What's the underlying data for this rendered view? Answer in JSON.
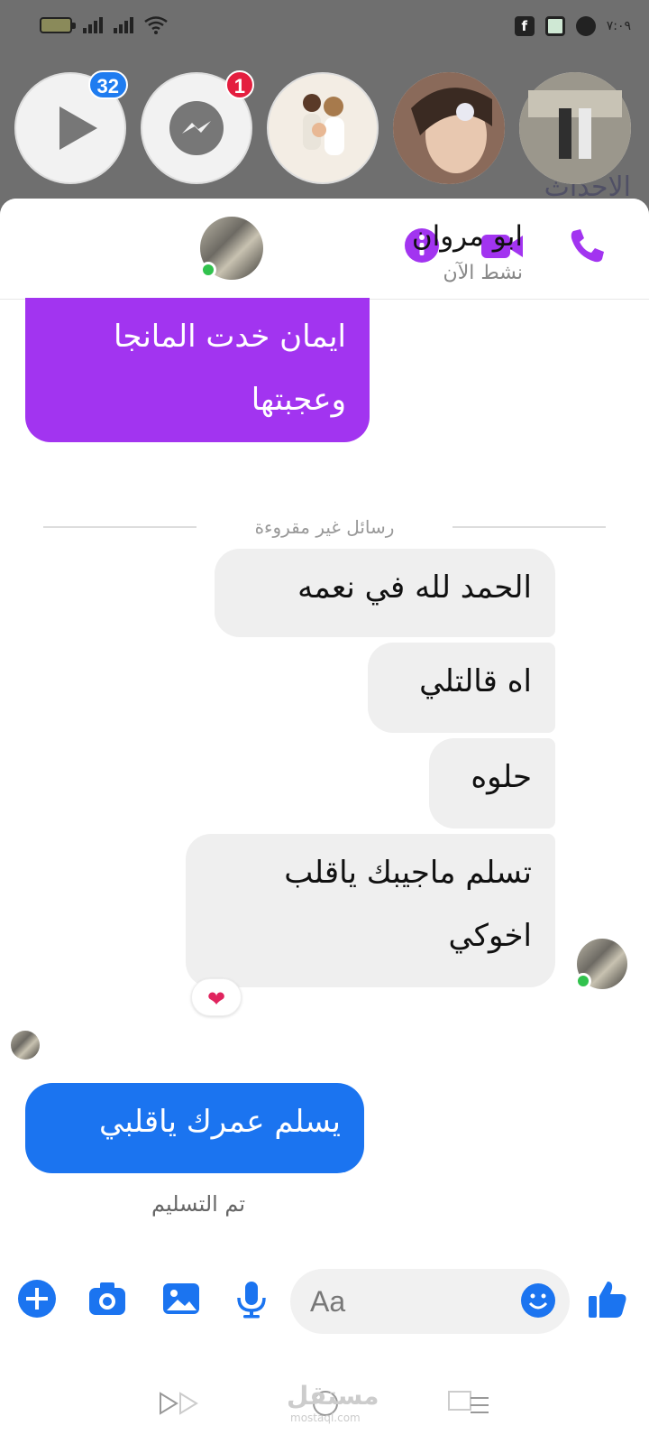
{
  "status_bar": {
    "time": "٧:٠٩"
  },
  "chat_heads": [
    {
      "name": "video-chathead",
      "badge": "32",
      "badge_color": "#1f7cf0"
    },
    {
      "name": "messenger-chathead",
      "badge": "1",
      "badge_color": "#e41e3f"
    },
    {
      "name": "family-chathead"
    },
    {
      "name": "portrait-chathead"
    },
    {
      "name": "group-photo-chathead"
    }
  ],
  "contact": {
    "name": "ابو مروان",
    "status": "نشط الآن"
  },
  "messages": {
    "sent_1": [
      "ايمان خدت المانجا",
      "وعجبتها"
    ],
    "divider": "رسائل غير مقروءة",
    "received": [
      [
        "الحمد لله في نعمه"
      ],
      [
        "اه قالتلي"
      ],
      [
        "حلوه"
      ],
      [
        "تسلم ماجيبك ياقلب",
        "اخوكي"
      ]
    ],
    "reaction": "❤",
    "sent_2": "يسلم عمرك ياقلبي",
    "delivery_status": "تم التسليم"
  },
  "composer": {
    "placeholder": "Aa"
  },
  "watermark": {
    "text": "مستقل",
    "sub": "mostaql.com"
  },
  "colors": {
    "accent": "#a234f0",
    "blue": "#1b74f0",
    "online": "#31c24d"
  }
}
